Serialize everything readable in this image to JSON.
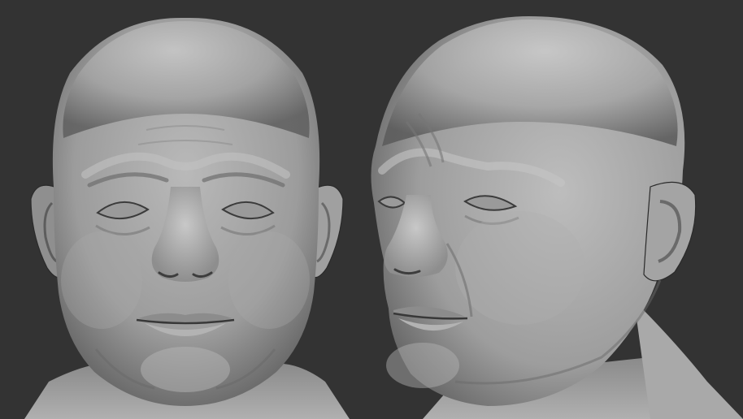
{
  "scene": {
    "background_color": "#333333",
    "clay_color": "#9a9a9a",
    "clay_highlight": "#c4c4c4",
    "clay_shadow": "#4a4a4a",
    "views": [
      {
        "id": "front",
        "label": ""
      },
      {
        "id": "three-quarter",
        "label": ""
      }
    ]
  }
}
